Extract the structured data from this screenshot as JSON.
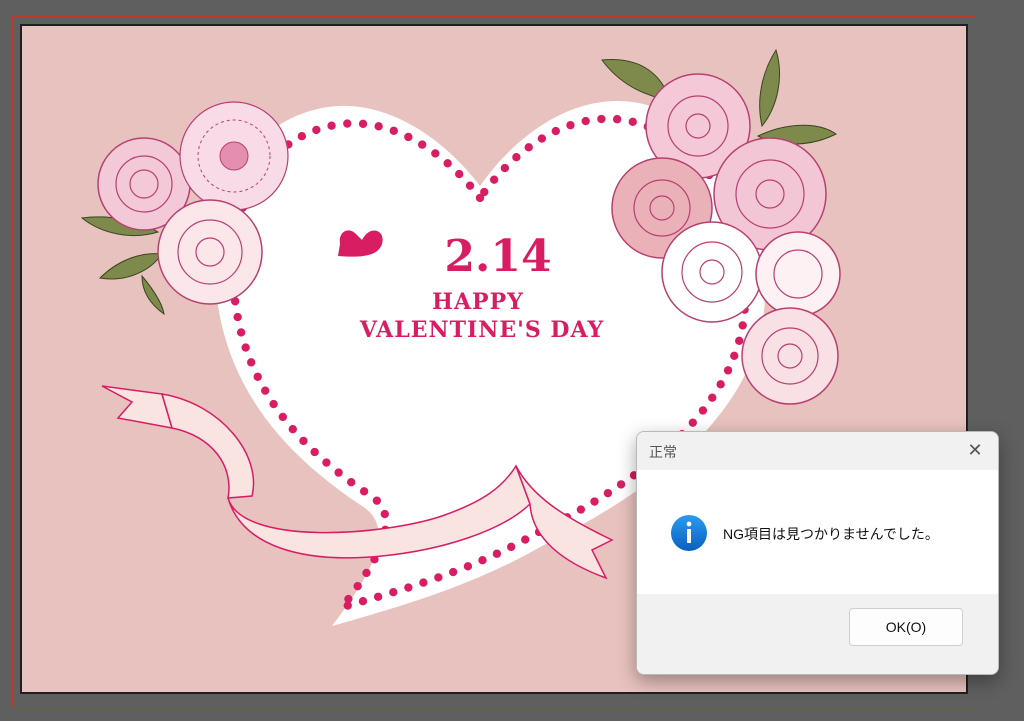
{
  "artwork": {
    "date": "2.14",
    "greeting_line1": "HAPPY",
    "greeting_line2": "VALENTINE'S DAY",
    "colors": {
      "background": "#e8c2be",
      "accent": "#d81d63",
      "heart_fill": "#ffffff"
    }
  },
  "dialog": {
    "title": "正常",
    "close_icon": "close-icon",
    "info_icon": "info-icon",
    "message": "NG項目は見つかりませんでした。",
    "ok_label": "OK(O)"
  }
}
